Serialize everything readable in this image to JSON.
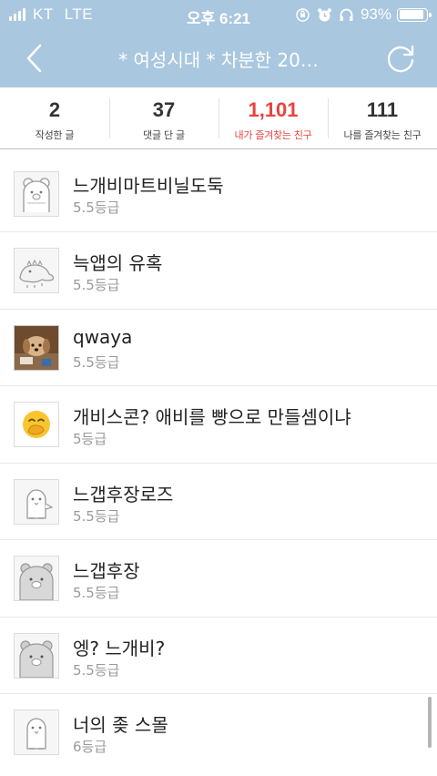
{
  "status_bar": {
    "carrier": "KT",
    "network": "LTE",
    "time": "오후 6:21",
    "battery": "93%",
    "battery_level": 0.93
  },
  "nav": {
    "title": "* 여성시대 *  차분한 20…",
    "back_icon": "chevron-left-icon",
    "refresh_icon": "refresh-icon",
    "background": "#a9c7df"
  },
  "stats": [
    {
      "value": "2",
      "label": "작성한 글",
      "active": false
    },
    {
      "value": "37",
      "label": "댓글 단 글",
      "active": false
    },
    {
      "value": "1,101",
      "label": "내가 즐겨찾는 친구",
      "active": true
    },
    {
      "value": "111",
      "label": "나를 즐겨찾는 친구",
      "active": false
    }
  ],
  "accent_color": "#e8433f",
  "friends": [
    {
      "name": "느개비마트비닐도둑",
      "grade": "5.5등급",
      "avatar": "bear-avatar"
    },
    {
      "name": "늑앱의 유혹",
      "grade": "5.5등급",
      "avatar": "dinosaur-avatar"
    },
    {
      "name": "qwaya",
      "grade": "5.5등급",
      "avatar": "dog-photo-avatar"
    },
    {
      "name": "개비스콘? 애비를 빵으로 만들셈이냐",
      "grade": "5등급",
      "avatar": "hand-over-mouth-emoji-avatar"
    },
    {
      "name": "느갭후장로즈",
      "grade": "5.5등급",
      "avatar": "penguin-avatar"
    },
    {
      "name": "느갭후장",
      "grade": "5.5등급",
      "avatar": "gray-bear-avatar"
    },
    {
      "name": "엥? 느개비?",
      "grade": "5.5등급",
      "avatar": "gray-bear-avatar"
    },
    {
      "name": "너의 좆 스몰",
      "grade": "6등급",
      "avatar": "penguin-avatar"
    }
  ]
}
